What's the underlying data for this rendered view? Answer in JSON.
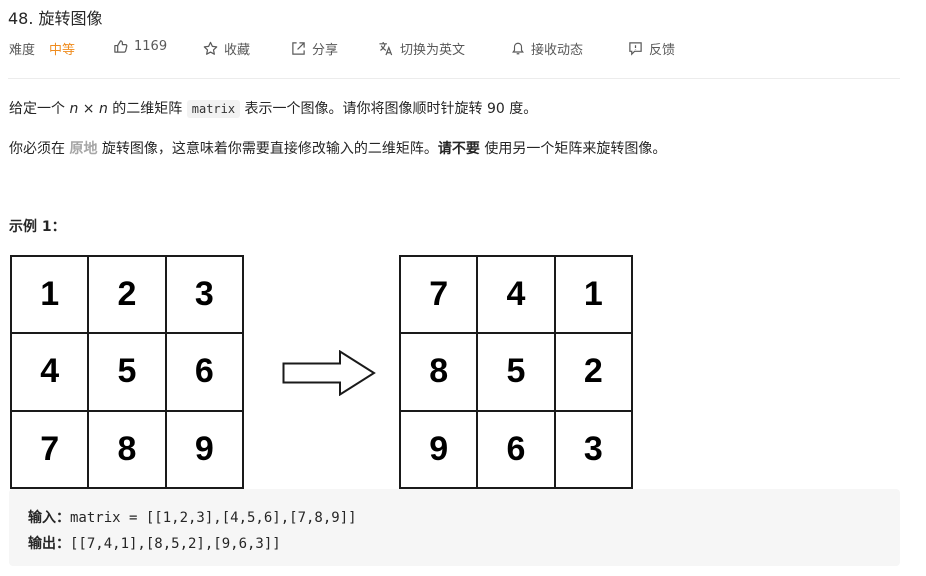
{
  "problem": {
    "title": "48. 旋转图像"
  },
  "meta": {
    "difficulty_label": "难度",
    "difficulty_value": "中等",
    "likes": "1169",
    "favorite_label": "收藏",
    "share_label": "分享",
    "switch_lang_label": "切换为英文",
    "notify_label": "接收动态",
    "feedback_label": "反馈",
    "colors": {
      "difficulty": "#ef8c1f"
    },
    "icons": [
      "thumbs-up-icon",
      "star-icon",
      "share-icon",
      "translate-icon",
      "bell-icon",
      "feedback-icon"
    ]
  },
  "description": {
    "p1": {
      "t1": "给定一个 ",
      "n1": "n",
      "x": " × ",
      "n2": "n",
      "t2": " 的二维矩阵 ",
      "code": "matrix",
      "t3": " 表示一个图像。请你将图像顺时针旋转 90 度。"
    },
    "p2": {
      "t1": "你必须在 ",
      "bold1": "原地",
      "t2": " 旋转图像，这意味着你需要直接修改输入的二维矩阵。",
      "bold2": "请不要",
      "t3": " 使用另一个矩阵来旋转图像。"
    }
  },
  "example": {
    "title": "示例 1：",
    "input_grid": [
      [
        "1",
        "2",
        "3"
      ],
      [
        "4",
        "5",
        "6"
      ],
      [
        "7",
        "8",
        "9"
      ]
    ],
    "output_grid": [
      [
        "7",
        "4",
        "1"
      ],
      [
        "8",
        "5",
        "2"
      ],
      [
        "9",
        "6",
        "3"
      ]
    ],
    "input_label": "输入：",
    "input_value": "matrix = [[1,2,3],[4,5,6],[7,8,9]]",
    "output_label": "输出：",
    "output_value": "[[7,4,1],[8,5,2],[9,6,3]]"
  }
}
